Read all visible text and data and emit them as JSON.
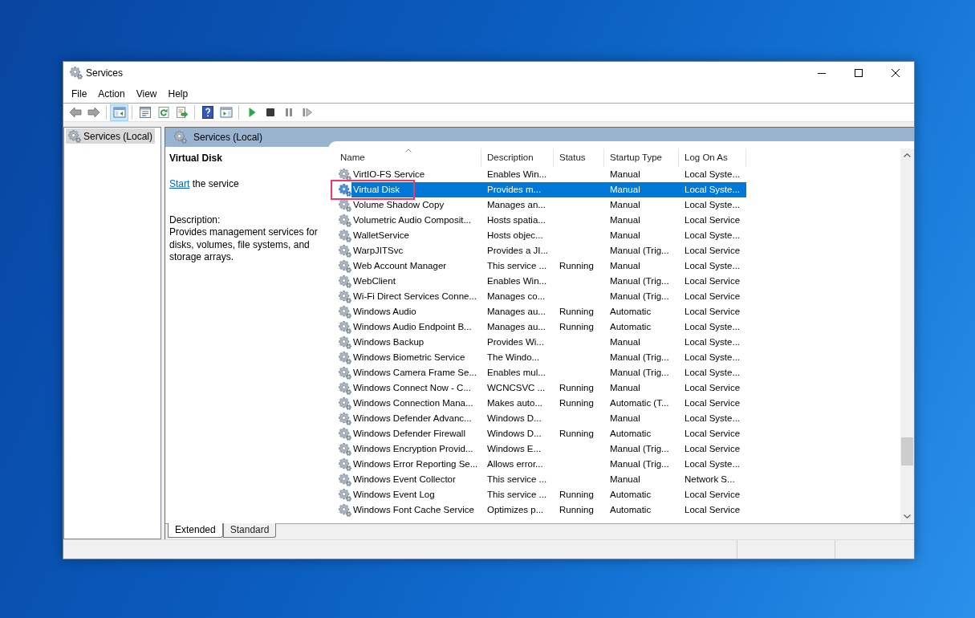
{
  "window": {
    "title": "Services"
  },
  "menu": [
    "File",
    "Action",
    "View",
    "Help"
  ],
  "toolbar": [
    [
      {
        "kind": "back",
        "pressed": false
      },
      {
        "kind": "forward",
        "pressed": false
      }
    ],
    [
      {
        "kind": "console-tree",
        "pressed": true
      }
    ],
    [
      {
        "kind": "properties",
        "pressed": false
      },
      {
        "kind": "refresh",
        "pressed": false
      },
      {
        "kind": "export",
        "pressed": false
      }
    ],
    [
      {
        "kind": "help",
        "pressed": false
      },
      {
        "kind": "action-pane",
        "pressed": false
      }
    ],
    [
      {
        "kind": "start",
        "pressed": false
      },
      {
        "kind": "stop",
        "pressed": false
      },
      {
        "kind": "pause",
        "pressed": false
      },
      {
        "kind": "resume",
        "pressed": false
      }
    ]
  ],
  "tree": [
    {
      "label": "Services (Local)",
      "selected": true
    }
  ],
  "pane_header": {
    "title": "Services (Local)"
  },
  "details": {
    "title": "Virtual Disk",
    "link": "Start",
    "link_rest": "the service",
    "description_label": "Description:",
    "description": "Provides management services for disks, volumes, file systems, and storage arrays."
  },
  "table": {
    "columns": [
      {
        "label": "Name",
        "sorted": true
      },
      {
        "label": "Description",
        "sorted": false
      },
      {
        "label": "Status",
        "sorted": false
      },
      {
        "label": "Startup Type",
        "sorted": false
      },
      {
        "label": "Log On As",
        "sorted": false
      }
    ],
    "rows": [
      {
        "name": "VirtIO-FS Service",
        "description": "Enables Win...",
        "startup_type": "Manual",
        "log_on_as": "Local Syste...",
        "selected": false,
        "annotated": false
      },
      {
        "name": "Virtual Disk",
        "description": "Provides m...",
        "startup_type": "Manual",
        "log_on_as": "Local Syste...",
        "selected": true,
        "annotated": true
      },
      {
        "name": "Volume Shadow Copy",
        "description": "Manages an...",
        "startup_type": "Manual",
        "log_on_as": "Local Syste...",
        "selected": false,
        "annotated": false
      },
      {
        "name": "Volumetric Audio Composit...",
        "description": "Hosts spatia...",
        "startup_type": "Manual",
        "log_on_as": "Local Service",
        "selected": false,
        "annotated": false
      },
      {
        "name": "WalletService",
        "description": "Hosts objec...",
        "startup_type": "Manual",
        "log_on_as": "Local Syste...",
        "selected": false,
        "annotated": false
      },
      {
        "name": "WarpJITSvc",
        "description": "Provides a JI...",
        "startup_type": "Manual (Trig...",
        "log_on_as": "Local Service",
        "selected": false,
        "annotated": false
      },
      {
        "name": "Web Account Manager",
        "description": "This service ...",
        "status": "Running",
        "startup_type": "Manual",
        "log_on_as": "Local Syste...",
        "selected": false,
        "annotated": false
      },
      {
        "name": "WebClient",
        "description": "Enables Win...",
        "startup_type": "Manual (Trig...",
        "log_on_as": "Local Service",
        "selected": false,
        "annotated": false
      },
      {
        "name": "Wi-Fi Direct Services Conne...",
        "description": "Manages co...",
        "startup_type": "Manual (Trig...",
        "log_on_as": "Local Service",
        "selected": false,
        "annotated": false
      },
      {
        "name": "Windows Audio",
        "description": "Manages au...",
        "status": "Running",
        "startup_type": "Automatic",
        "log_on_as": "Local Service",
        "selected": false,
        "annotated": false
      },
      {
        "name": "Windows Audio Endpoint B...",
        "description": "Manages au...",
        "status": "Running",
        "startup_type": "Automatic",
        "log_on_as": "Local Syste...",
        "selected": false,
        "annotated": false
      },
      {
        "name": "Windows Backup",
        "description": "Provides Wi...",
        "startup_type": "Manual",
        "log_on_as": "Local Syste...",
        "selected": false,
        "annotated": false
      },
      {
        "name": "Windows Biometric Service",
        "description": "The Windo...",
        "startup_type": "Manual (Trig...",
        "log_on_as": "Local Syste...",
        "selected": false,
        "annotated": false
      },
      {
        "name": "Windows Camera Frame Se...",
        "description": "Enables mul...",
        "startup_type": "Manual (Trig...",
        "log_on_as": "Local Syste...",
        "selected": false,
        "annotated": false
      },
      {
        "name": "Windows Connect Now - C...",
        "description": "WCNCSVC ...",
        "status": "Running",
        "startup_type": "Manual",
        "log_on_as": "Local Service",
        "selected": false,
        "annotated": false
      },
      {
        "name": "Windows Connection Mana...",
        "description": "Makes auto...",
        "status": "Running",
        "startup_type": "Automatic (T...",
        "log_on_as": "Local Service",
        "selected": false,
        "annotated": false
      },
      {
        "name": "Windows Defender Advanc...",
        "description": "Windows D...",
        "startup_type": "Manual",
        "log_on_as": "Local Syste...",
        "selected": false,
        "annotated": false
      },
      {
        "name": "Windows Defender Firewall",
        "description": "Windows D...",
        "status": "Running",
        "startup_type": "Automatic",
        "log_on_as": "Local Service",
        "selected": false,
        "annotated": false
      },
      {
        "name": "Windows Encryption Provid...",
        "description": "Windows E...",
        "startup_type": "Manual (Trig...",
        "log_on_as": "Local Service",
        "selected": false,
        "annotated": false
      },
      {
        "name": "Windows Error Reporting Se...",
        "description": "Allows error...",
        "startup_type": "Manual (Trig...",
        "log_on_as": "Local Syste...",
        "selected": false,
        "annotated": false
      },
      {
        "name": "Windows Event Collector",
        "description": "This service ...",
        "startup_type": "Manual",
        "log_on_as": "Network S...",
        "selected": false,
        "annotated": false
      },
      {
        "name": "Windows Event Log",
        "description": "This service ...",
        "status": "Running",
        "startup_type": "Automatic",
        "log_on_as": "Local Service",
        "selected": false,
        "annotated": false
      },
      {
        "name": "Windows Font Cache Service",
        "description": "Optimizes p...",
        "status": "Running",
        "startup_type": "Automatic",
        "log_on_as": "Local Service",
        "selected": false,
        "annotated": false
      }
    ]
  },
  "view_tabs": [
    {
      "label": "Extended",
      "selected": true
    },
    {
      "label": "Standard",
      "selected": false
    }
  ]
}
